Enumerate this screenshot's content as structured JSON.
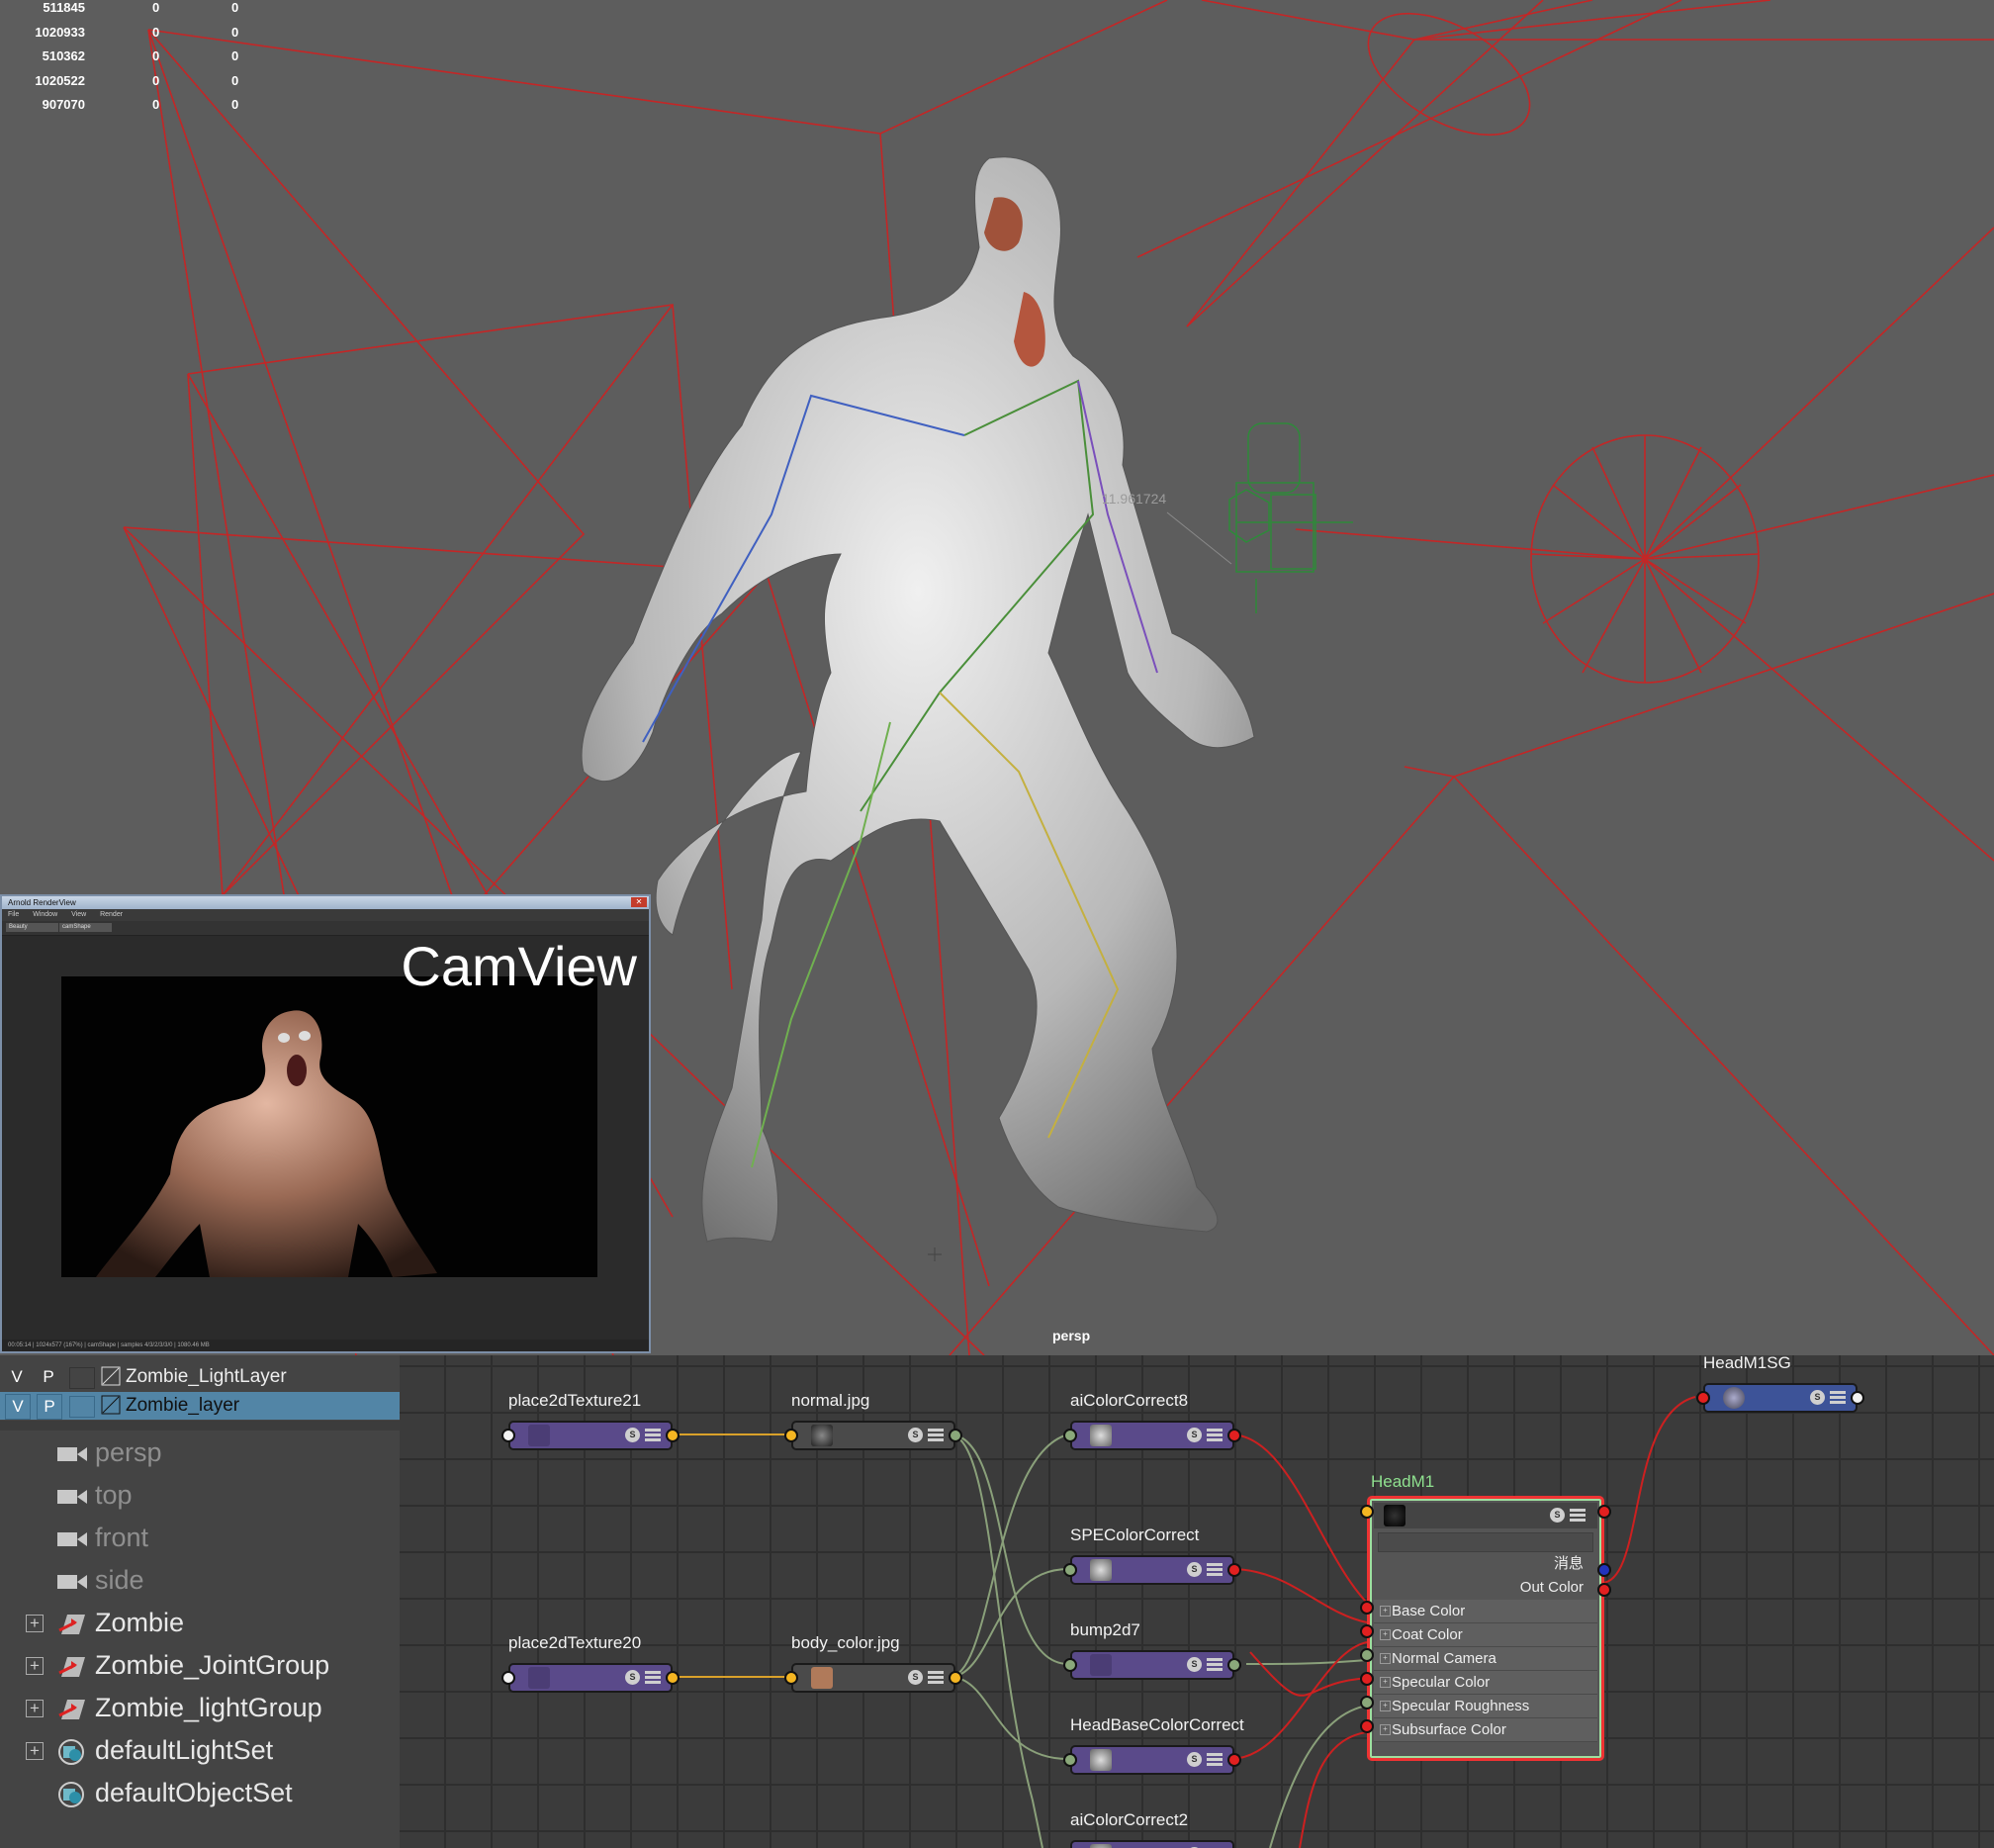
{
  "viewport": {
    "camera_name": "persp",
    "distance_readout": "11.961724",
    "stats_rows": [
      [
        "511845",
        "0",
        "0"
      ],
      [
        "1020933",
        "0",
        "0"
      ],
      [
        "510362",
        "0",
        "0"
      ],
      [
        "1020522",
        "0",
        "0"
      ],
      [
        "907070",
        "0",
        "0"
      ]
    ],
    "colors": {
      "background": "#5d5d5d",
      "light_wire": "#c42626",
      "camera_wire": "#2e8a3a"
    }
  },
  "render_view": {
    "window_title": "Arnold RenderView",
    "menu": [
      "File",
      "Window",
      "View",
      "Render"
    ],
    "aov_select": "Beauty",
    "camera_select": "camShape",
    "overlay_label": "CamView",
    "status_text": "00:05:14 | 1024x577 (167%) | camShape | samples 4/3/2/3/3/0 | 1080.46 MB"
  },
  "layers": [
    {
      "visible": "V",
      "playback": "P",
      "name": "Zombie_LightLayer",
      "selected": false
    },
    {
      "visible": "V",
      "playback": "P",
      "name": "Zombie_layer",
      "selected": true
    }
  ],
  "outliner": [
    {
      "label": "persp",
      "icon": "camera-icon",
      "dim": true,
      "expandable": false
    },
    {
      "label": "top",
      "icon": "camera-icon",
      "dim": true,
      "expandable": false
    },
    {
      "label": "front",
      "icon": "camera-icon",
      "dim": true,
      "expandable": false
    },
    {
      "label": "side",
      "icon": "camera-icon",
      "dim": true,
      "expandable": false
    },
    {
      "label": "Zombie",
      "icon": "group-transform-icon",
      "dim": false,
      "expandable": true
    },
    {
      "label": "Zombie_JointGroup",
      "icon": "group-transform-icon",
      "dim": false,
      "expandable": true
    },
    {
      "label": "Zombie_lightGroup",
      "icon": "group-transform-icon",
      "dim": false,
      "expandable": true
    },
    {
      "label": "defaultLightSet",
      "icon": "set-icon",
      "dim": false,
      "expandable": true
    },
    {
      "label": "defaultObjectSet",
      "icon": "set-icon",
      "dim": false,
      "expandable": false
    }
  ],
  "nodes": {
    "place2dTexture21": "place2dTexture21",
    "normal_jpg": "normal.jpg",
    "aiColorCorrect8": "aiColorCorrect8",
    "SPEColorCorrect": "SPEColorCorrect",
    "place2dTexture20": "place2dTexture20",
    "body_color_jpg": "body_color.jpg",
    "bump2d7": "bump2d7",
    "HeadBaseColorCorrect": "HeadBaseColorCorrect",
    "aiColorCorrect2": "aiColorCorrect2",
    "HeadM1SG": "HeadM1SG",
    "swatch_button": "S"
  },
  "shader_node": {
    "title": "HeadM1",
    "message_label": "消息",
    "out_label": "Out Color",
    "inputs": [
      "Base Color",
      "Coat Color",
      "Normal Camera",
      "Specular Color",
      "Specular Roughness",
      "Subsurface Color"
    ]
  }
}
